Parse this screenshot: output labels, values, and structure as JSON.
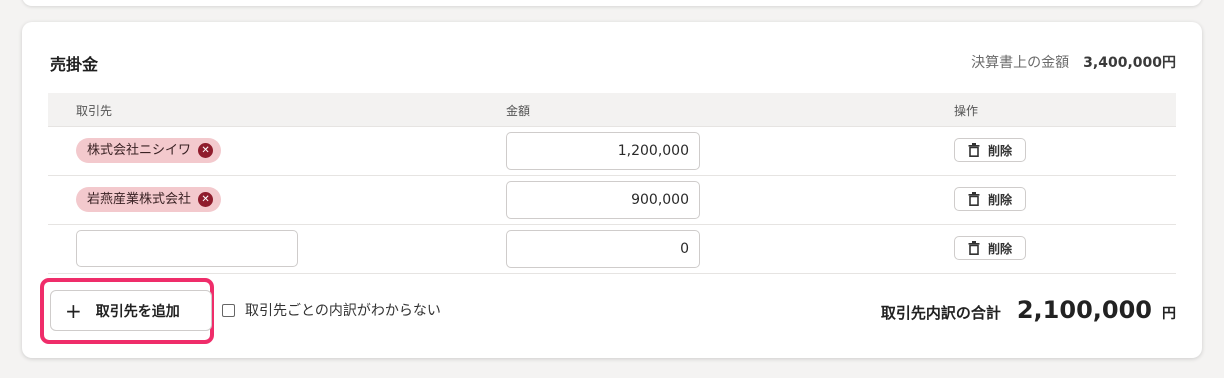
{
  "section": {
    "title": "売掛金",
    "fs_amount_label": "決算書上の金額",
    "fs_amount_value": "3,400,000円"
  },
  "table": {
    "headers": {
      "partner": "取引先",
      "amount": "金額",
      "action": "操作"
    },
    "rows": [
      {
        "partner": "株式会社ニシイワ",
        "amount": "1,200,000",
        "delete_label": "削除"
      },
      {
        "partner": "岩燕産業株式会社",
        "amount": "900,000",
        "delete_label": "削除"
      },
      {
        "partner": "",
        "amount": "0",
        "delete_label": "削除"
      }
    ]
  },
  "footer": {
    "add_button_label": "取引先を追加",
    "unknown_breakdown_label": "取引先ごとの内訳がわからない",
    "total_label": "取引先内訳の合計",
    "total_value": "2,100,000",
    "total_unit": "円"
  },
  "colors": {
    "tag_background": "#f3c9cd",
    "tag_remove": "#8f1c2c",
    "highlight": "#ef2d6a"
  }
}
